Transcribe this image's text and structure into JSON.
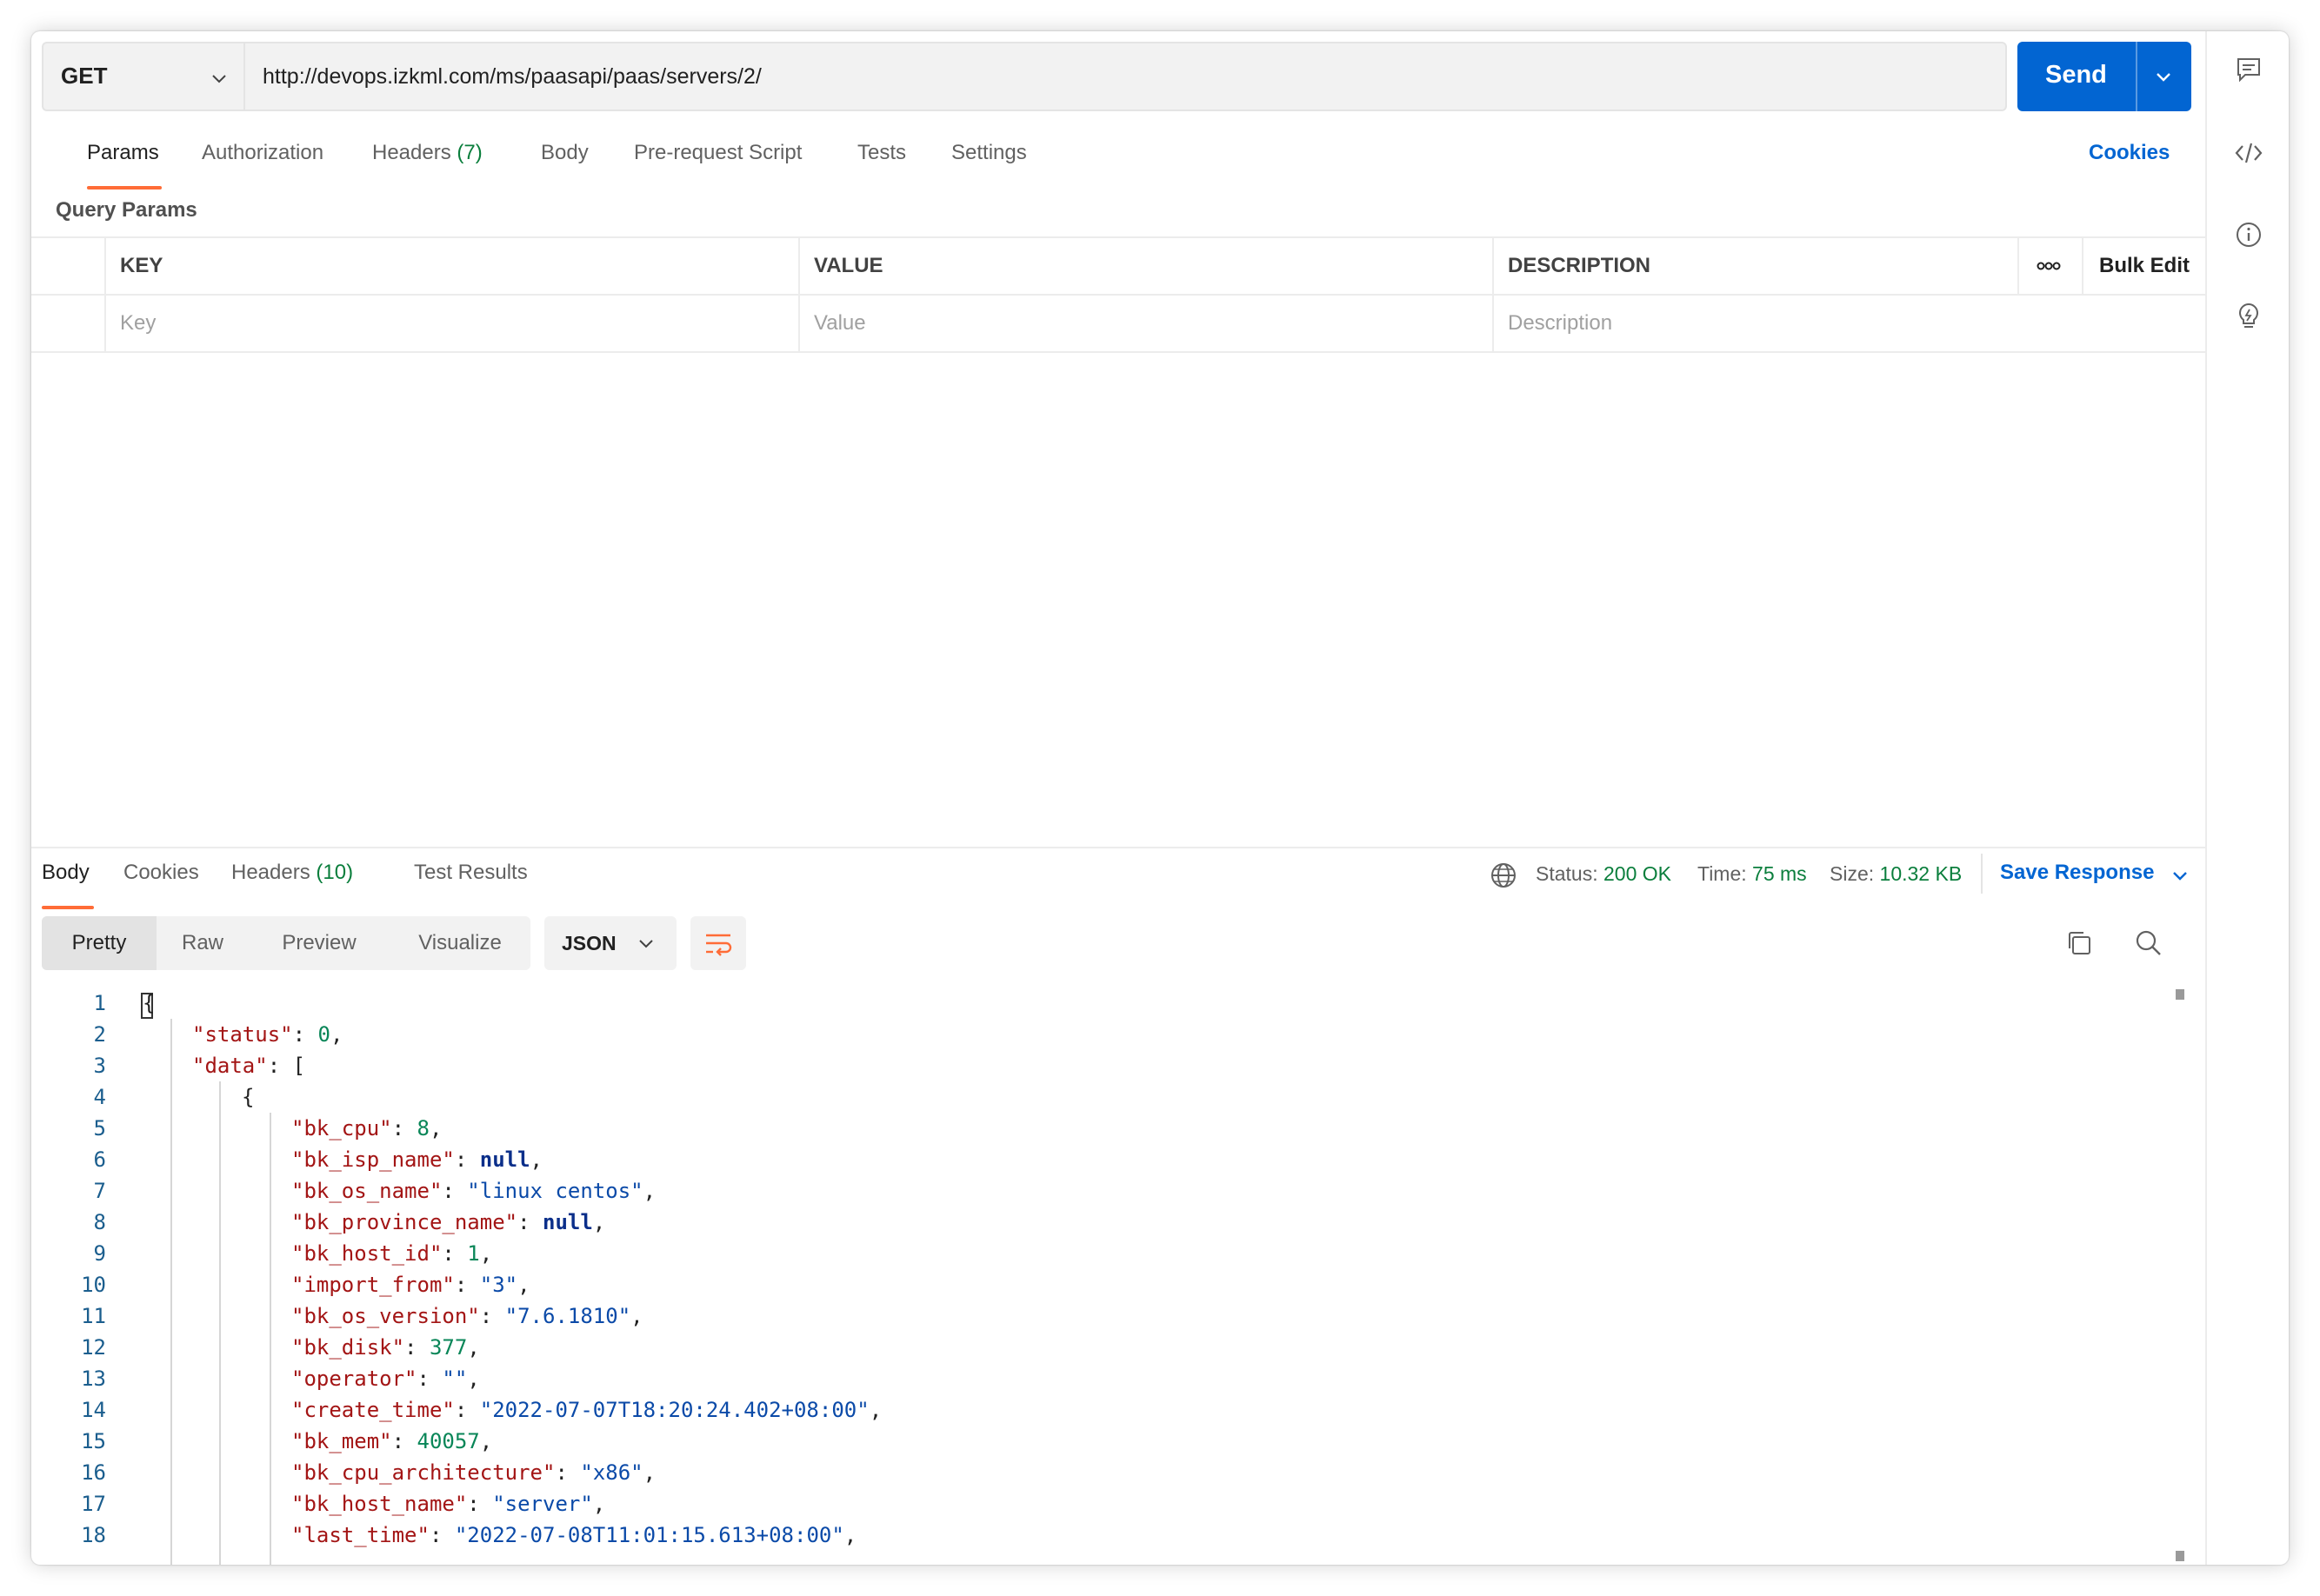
{
  "request": {
    "method": "GET",
    "url": "http://devops.izkml.com/ms/paasapi/paas/servers/2/",
    "send_label": "Send"
  },
  "request_tabs": [
    {
      "label": "Params",
      "count": ""
    },
    {
      "label": "Authorization",
      "count": ""
    },
    {
      "label": "Headers",
      "count": "(7)"
    },
    {
      "label": "Body",
      "count": ""
    },
    {
      "label": "Pre-request Script",
      "count": ""
    },
    {
      "label": "Tests",
      "count": ""
    },
    {
      "label": "Settings",
      "count": ""
    }
  ],
  "cookies_link": "Cookies",
  "query_params": {
    "title": "Query Params",
    "columns": {
      "key": "KEY",
      "value": "VALUE",
      "description": "DESCRIPTION"
    },
    "bulk_edit": "Bulk Edit",
    "placeholders": {
      "key": "Key",
      "value": "Value",
      "description": "Description"
    }
  },
  "response_tabs": [
    {
      "label": "Body",
      "count": ""
    },
    {
      "label": "Cookies",
      "count": ""
    },
    {
      "label": "Headers",
      "count": "(10)"
    },
    {
      "label": "Test Results",
      "count": ""
    }
  ],
  "response_meta": {
    "status_label": "Status:",
    "status_value": "200 OK",
    "time_label": "Time:",
    "time_value": "75 ms",
    "size_label": "Size:",
    "size_value": "10.32 KB",
    "save_label": "Save Response"
  },
  "view_modes": [
    "Pretty",
    "Raw",
    "Preview",
    "Visualize"
  ],
  "format": "JSON",
  "colors": {
    "accent": "#ff6c37",
    "primary": "#0265d2",
    "success": "#0a7e3c"
  },
  "code_lines": [
    {
      "n": "1",
      "indent": 0,
      "parts": [
        [
          "p",
          "{"
        ]
      ]
    },
    {
      "n": "2",
      "indent": 1,
      "parts": [
        [
          "k",
          "\"status\""
        ],
        [
          "p",
          ": "
        ],
        [
          "n",
          "0"
        ],
        [
          "p",
          ","
        ]
      ]
    },
    {
      "n": "3",
      "indent": 1,
      "parts": [
        [
          "k",
          "\"data\""
        ],
        [
          "p",
          ": ["
        ]
      ]
    },
    {
      "n": "4",
      "indent": 2,
      "parts": [
        [
          "p",
          "{"
        ]
      ]
    },
    {
      "n": "5",
      "indent": 3,
      "parts": [
        [
          "k",
          "\"bk_cpu\""
        ],
        [
          "p",
          ": "
        ],
        [
          "n",
          "8"
        ],
        [
          "p",
          ","
        ]
      ]
    },
    {
      "n": "6",
      "indent": 3,
      "parts": [
        [
          "k",
          "\"bk_isp_name\""
        ],
        [
          "p",
          ": "
        ],
        [
          "nl",
          "null"
        ],
        [
          "p",
          ","
        ]
      ]
    },
    {
      "n": "7",
      "indent": 3,
      "parts": [
        [
          "k",
          "\"bk_os_name\""
        ],
        [
          "p",
          ": "
        ],
        [
          "s",
          "\"linux centos\""
        ],
        [
          "p",
          ","
        ]
      ]
    },
    {
      "n": "8",
      "indent": 3,
      "parts": [
        [
          "k",
          "\"bk_province_name\""
        ],
        [
          "p",
          ": "
        ],
        [
          "nl",
          "null"
        ],
        [
          "p",
          ","
        ]
      ]
    },
    {
      "n": "9",
      "indent": 3,
      "parts": [
        [
          "k",
          "\"bk_host_id\""
        ],
        [
          "p",
          ": "
        ],
        [
          "n",
          "1"
        ],
        [
          "p",
          ","
        ]
      ]
    },
    {
      "n": "10",
      "indent": 3,
      "parts": [
        [
          "k",
          "\"import_from\""
        ],
        [
          "p",
          ": "
        ],
        [
          "s",
          "\"3\""
        ],
        [
          "p",
          ","
        ]
      ]
    },
    {
      "n": "11",
      "indent": 3,
      "parts": [
        [
          "k",
          "\"bk_os_version\""
        ],
        [
          "p",
          ": "
        ],
        [
          "s",
          "\"7.6.1810\""
        ],
        [
          "p",
          ","
        ]
      ]
    },
    {
      "n": "12",
      "indent": 3,
      "parts": [
        [
          "k",
          "\"bk_disk\""
        ],
        [
          "p",
          ": "
        ],
        [
          "n",
          "377"
        ],
        [
          "p",
          ","
        ]
      ]
    },
    {
      "n": "13",
      "indent": 3,
      "parts": [
        [
          "k",
          "\"operator\""
        ],
        [
          "p",
          ": "
        ],
        [
          "s",
          "\"\""
        ],
        [
          "p",
          ","
        ]
      ]
    },
    {
      "n": "14",
      "indent": 3,
      "parts": [
        [
          "k",
          "\"create_time\""
        ],
        [
          "p",
          ": "
        ],
        [
          "s",
          "\"2022-07-07T18:20:24.402+08:00\""
        ],
        [
          "p",
          ","
        ]
      ]
    },
    {
      "n": "15",
      "indent": 3,
      "parts": [
        [
          "k",
          "\"bk_mem\""
        ],
        [
          "p",
          ": "
        ],
        [
          "n",
          "40057"
        ],
        [
          "p",
          ","
        ]
      ]
    },
    {
      "n": "16",
      "indent": 3,
      "parts": [
        [
          "k",
          "\"bk_cpu_architecture\""
        ],
        [
          "p",
          ": "
        ],
        [
          "s",
          "\"x86\""
        ],
        [
          "p",
          ","
        ]
      ]
    },
    {
      "n": "17",
      "indent": 3,
      "parts": [
        [
          "k",
          "\"bk_host_name\""
        ],
        [
          "p",
          ": "
        ],
        [
          "s",
          "\"server\""
        ],
        [
          "p",
          ","
        ]
      ]
    },
    {
      "n": "18",
      "indent": 3,
      "parts": [
        [
          "k",
          "\"last_time\""
        ],
        [
          "p",
          ": "
        ],
        [
          "s",
          "\"2022-07-08T11:01:15.613+08:00\""
        ],
        [
          "p",
          ","
        ]
      ]
    }
  ],
  "icons": {
    "sidebar": [
      "comment-icon",
      "code-icon",
      "info-icon",
      "lightbulb-icon"
    ],
    "toolbar": [
      "wrap-lines-icon",
      "copy-icon",
      "search-icon",
      "globe-icon"
    ]
  }
}
